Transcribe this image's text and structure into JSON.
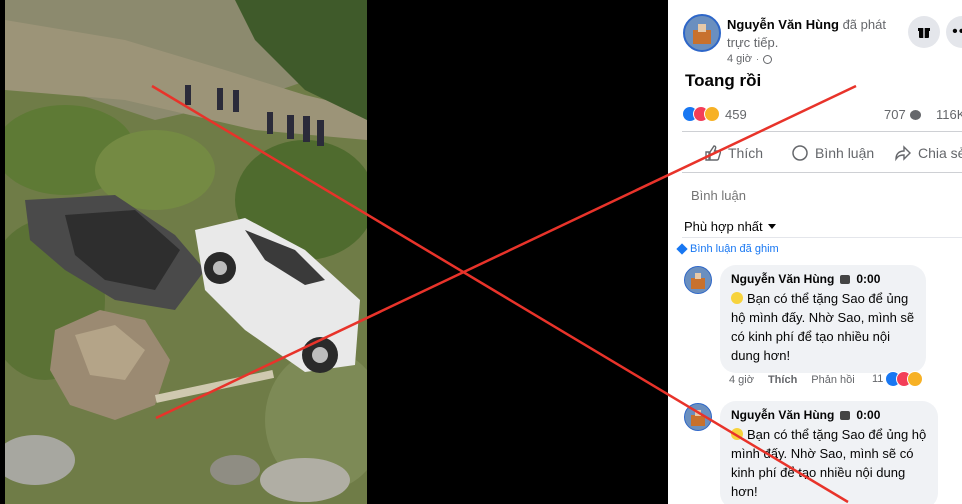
{
  "post": {
    "author": "Nguyễn Văn Hùng",
    "action_text": "đã phát trực tiếp.",
    "time": "4 giờ",
    "title": "Toang rồi",
    "reactions_count": "459",
    "comments_count": "707",
    "views_count": "116K"
  },
  "actions": {
    "like": "Thích",
    "comment": "Bình luận",
    "share": "Chia sẻ"
  },
  "comment_box": {
    "placeholder": "Bình luận"
  },
  "sort": {
    "label": "Phù hợp nhất"
  },
  "pinned_label": "Bình luận đã ghim",
  "comments": [
    {
      "author": "Nguyễn Văn Hùng",
      "timestamp": "0:00",
      "text": "Bạn có thể tặng Sao để ủng hộ mình đấy. Nhờ Sao, mình sẽ có kinh phí để tạo nhiều nội dung hơn!",
      "time": "4 giờ",
      "like_label": "Thích",
      "reply_label": "Phản hồi",
      "reaction_count": "11"
    },
    {
      "author": "Nguyễn Văn Hùng",
      "timestamp": "0:00",
      "text": "Bạn có thể tặng Sao để ủng hộ mình đấy. Nhờ Sao, mình sẽ có kinh phí để tạo nhiều nội dung hơn!"
    }
  ],
  "colors": {
    "overlay_x": "#e8332a",
    "facebook_blue": "#1877f2",
    "panel_bg": "#ffffff"
  }
}
